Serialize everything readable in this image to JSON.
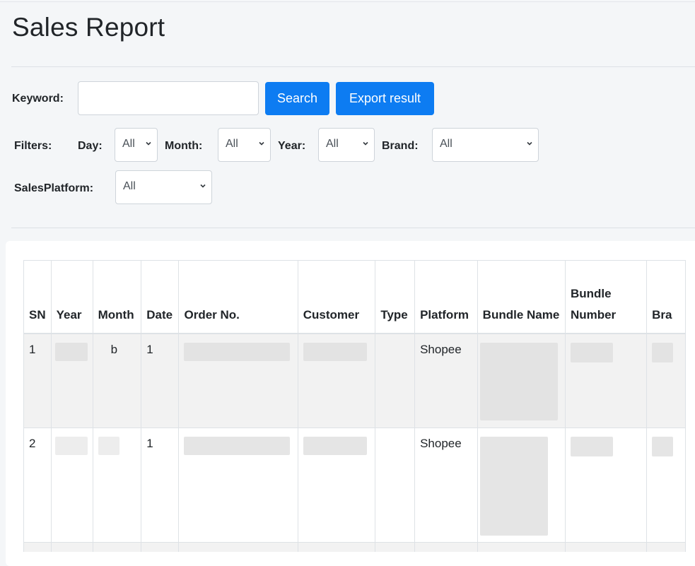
{
  "page": {
    "title": "Sales Report"
  },
  "search": {
    "keyword_label": "Keyword:",
    "keyword_value": "",
    "search_button": "Search",
    "export_button": "Export result"
  },
  "filters": {
    "label": "Filters:",
    "day": {
      "label": "Day:",
      "selected": "All"
    },
    "month": {
      "label": "Month:",
      "selected": "All"
    },
    "year": {
      "label": "Year:",
      "selected": "All"
    },
    "brand": {
      "label": "Brand:",
      "selected": "All"
    },
    "sales_platform": {
      "label": "SalesPlatform:",
      "selected": "All"
    }
  },
  "table": {
    "columns": [
      "SN",
      "Year",
      "Month",
      "Date",
      "Order No.",
      "Customer",
      "Type",
      "Platform",
      "Bundle Name",
      "Bundle Number",
      "Bra"
    ],
    "rows": [
      {
        "sn": "1",
        "year": "",
        "month": "b",
        "date": "1",
        "order_no": "",
        "customer": "",
        "type": "",
        "platform": "Shopee",
        "bundle_name": "",
        "bundle_number": "",
        "brand": ""
      },
      {
        "sn": "2",
        "year": "",
        "month": "",
        "date": "1",
        "order_no": "",
        "customer": "",
        "type": "",
        "platform": "Shopee",
        "bundle_name": "",
        "bundle_number": "",
        "brand": ""
      }
    ]
  },
  "icons": {
    "select_arrow": "chevron-down-icon"
  }
}
